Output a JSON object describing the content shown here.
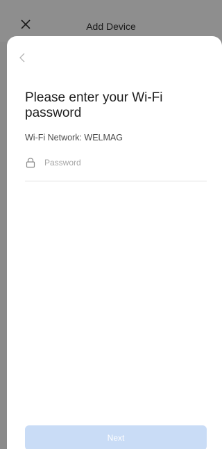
{
  "header": {
    "title": "Add Device",
    "close_icon": "close-icon"
  },
  "sheet": {
    "back_icon": "chevron-left-icon",
    "heading": "Please enter your Wi-Fi password",
    "network_label": "Wi-Fi Network: WELMAG",
    "password": {
      "icon": "lock-icon",
      "placeholder": "Password",
      "value": ""
    },
    "next_label": "Next"
  },
  "colors": {
    "overlay": "#8e8e8e",
    "sheet": "#ffffff",
    "next_disabled": "#c9dcf6"
  }
}
